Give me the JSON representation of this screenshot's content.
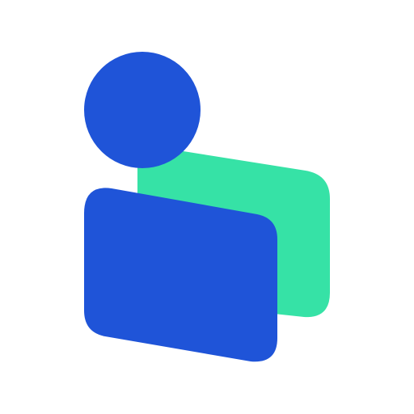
{
  "logo": {
    "icon": "users-icon",
    "colors": {
      "background": "#ffffff",
      "primary_blue": "#1F54D8",
      "accent_green": "#36E2A6"
    }
  }
}
